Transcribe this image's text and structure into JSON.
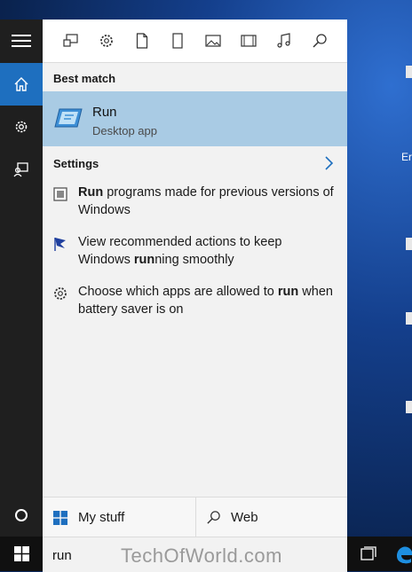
{
  "rail": {
    "items": [
      {
        "icon": "home-icon",
        "active": true
      },
      {
        "icon": "gear-icon",
        "active": false
      },
      {
        "icon": "feedback-icon",
        "active": false
      }
    ],
    "cortana_icon": "cortana-circle-icon"
  },
  "filters": [
    {
      "icon": "apps-icon"
    },
    {
      "icon": "settings-icon"
    },
    {
      "icon": "documents-icon"
    },
    {
      "icon": "folders-icon"
    },
    {
      "icon": "photos-icon"
    },
    {
      "icon": "videos-icon"
    },
    {
      "icon": "music-icon"
    },
    {
      "icon": "search-icon"
    }
  ],
  "best_match": {
    "heading": "Best match",
    "title": "Run",
    "subtitle": "Desktop app"
  },
  "settings": {
    "heading": "Settings",
    "items": [
      {
        "bold": "Run",
        "text": " programs made for previous versions of Windows",
        "icon": "run-compat-icon"
      },
      {
        "pre": "View recommended actions to keep Windows ",
        "bold": "run",
        "post": "ning smoothly",
        "icon": "flag-icon"
      },
      {
        "pre": "Choose which apps are allowed to ",
        "bold": "run",
        "post": " when battery saver is on",
        "icon": "gear-icon"
      }
    ]
  },
  "scope": {
    "my_stuff": "My stuff",
    "web": "Web"
  },
  "search": {
    "query": "run"
  },
  "watermark": "TechOfWorld.com",
  "desktop": {
    "label_1": "Er"
  },
  "colors": {
    "accent": "#1e6fbf",
    "selection": "#a9cbe4",
    "rail": "#1f1f1f",
    "panel": "#f2f2f2"
  }
}
